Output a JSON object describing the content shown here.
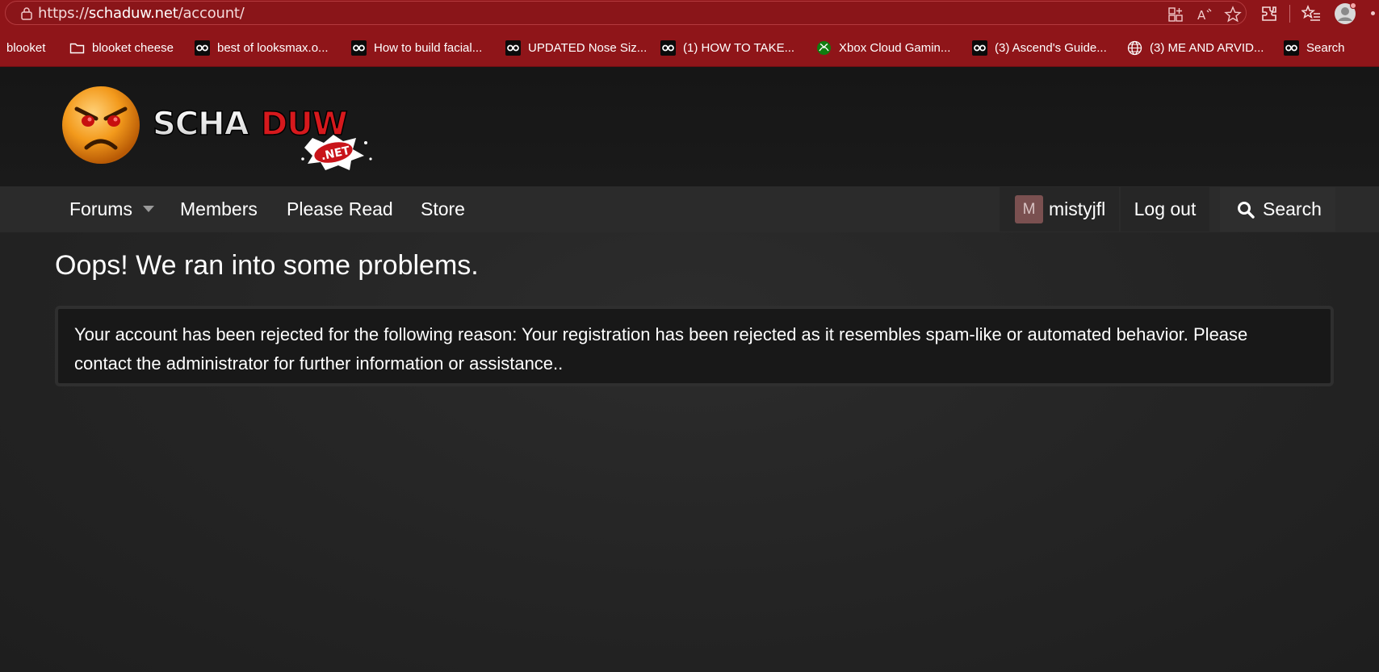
{
  "browser": {
    "url_scheme": "https://",
    "url_host": "schaduw.net",
    "url_path": "/account/"
  },
  "bookmarks": [
    {
      "label": "blooket",
      "icon": "none"
    },
    {
      "label": "blooket cheese",
      "icon": "folder-icon"
    },
    {
      "label": "best of looksmax.o...",
      "icon": "looksmax-icon"
    },
    {
      "label": "How to build facial...",
      "icon": "looksmax-icon"
    },
    {
      "label": "UPDATED Nose Siz...",
      "icon": "looksmax-icon"
    },
    {
      "label": "(1) HOW TO TAKE...",
      "icon": "looksmax-icon"
    },
    {
      "label": "Xbox Cloud Gamin...",
      "icon": "xbox-icon"
    },
    {
      "label": "(3) Ascend's Guide...",
      "icon": "looksmax-icon"
    },
    {
      "label": "(3) ME AND ARVID...",
      "icon": "globe-icon"
    },
    {
      "label": "Search",
      "icon": "looksmax-icon"
    }
  ],
  "site": {
    "logo_text_white": "SCHA",
    "logo_text_red": "DUW",
    "logo_badge": ".NET"
  },
  "nav": {
    "forums": "Forums",
    "members": "Members",
    "please_read": "Please Read",
    "store": "Store",
    "avatar_letter": "M",
    "username": "mistyjfl",
    "logout": "Log out",
    "search": "Search"
  },
  "main": {
    "title": "Oops! We ran into some problems.",
    "error_message": "Your account has been rejected for the following reason: Your registration has been rejected as it resembles spam-like or automated behavior. Please contact the administrator for further information or assistance.."
  },
  "colors": {
    "browser_accent": "#8f1519",
    "page_background": "#232323",
    "nav_background": "#2b2b2b",
    "logo_red": "#d6191d"
  }
}
